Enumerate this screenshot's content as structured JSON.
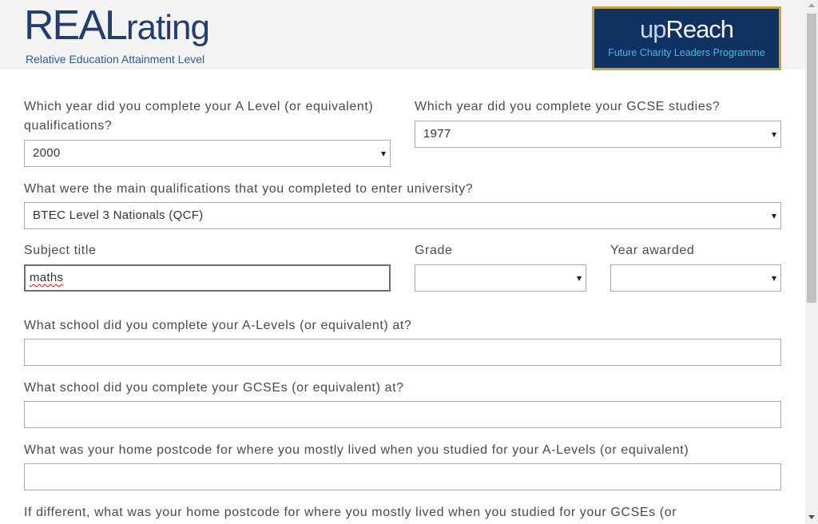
{
  "header": {
    "brand_strong": "REAL",
    "brand_light": "rating",
    "tagline": "Relative Education Attainment Level",
    "partner_up": "up",
    "partner_reach": "Reach",
    "partner_tagline": "Future Charity Leaders Programme"
  },
  "form": {
    "alevel_year_label": "Which year did you complete your A Level (or equivalent) qualifications?",
    "alevel_year_value": "2000",
    "gcse_year_label": "Which year did you complete your GCSE studies?",
    "gcse_year_value": "1977",
    "qualifications_label": "What were the main qualifications that you completed to enter university?",
    "qualifications_value": "BTEC Level 3 Nationals (QCF)",
    "subject_label": "Subject title",
    "subject_value": "maths",
    "grade_label": "Grade",
    "grade_value": "",
    "year_awarded_label": "Year awarded",
    "year_awarded_value": "",
    "alevel_school_label": "What school did you complete your A-Levels (or equivalent) at?",
    "alevel_school_value": "",
    "gcse_school_label": "What school did you complete your GCSEs (or equivalent) at?",
    "gcse_school_value": "",
    "alevel_postcode_label": "What was your home postcode for where you mostly lived when you studied for your A-Levels (or equivalent)",
    "alevel_postcode_value": "",
    "gcse_postcode_label": "If different, what was your home postcode for where you mostly lived when you studied for your GCSEs (or"
  }
}
